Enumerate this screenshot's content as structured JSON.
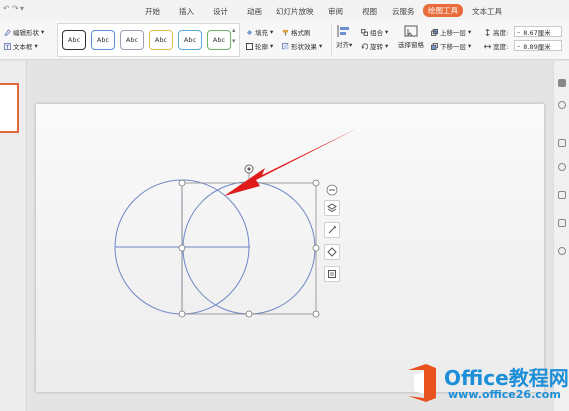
{
  "tabs": [
    {
      "label": "开始"
    },
    {
      "label": "插入"
    },
    {
      "label": "设计"
    },
    {
      "label": "动画"
    },
    {
      "label": "幻灯片放映"
    },
    {
      "label": "审阅"
    },
    {
      "label": "视图"
    },
    {
      "label": "云服务"
    },
    {
      "label": "绘图工具",
      "active": true
    },
    {
      "label": "文本工具"
    }
  ],
  "ribbon": {
    "edit_shape": "编辑形状",
    "text_box": "文本框",
    "gallery": [
      "Abc",
      "Abc",
      "Abc",
      "Abc",
      "Abc",
      "Abc"
    ],
    "fill": "填充",
    "format_brush": "格式刷",
    "outline": "轮廓",
    "shape_effect": "形状效果",
    "align": "对齐",
    "group": "组合",
    "rotate": "旋转",
    "selection_pane": "选择窗格",
    "bring_forward": "上移一层",
    "send_backward": "下移一层",
    "height_label": "高度:",
    "height_value": "8.67厘米",
    "width_label": "宽度:",
    "width_value": "8.89厘米"
  },
  "watermark": {
    "title": "Office教程网",
    "url": "www.office26.com"
  },
  "colors": {
    "accent": "#e86b3a",
    "shape_stroke": "#6f86c6",
    "arrow": "#e01b1b",
    "watermark": "#1d8ed8"
  }
}
